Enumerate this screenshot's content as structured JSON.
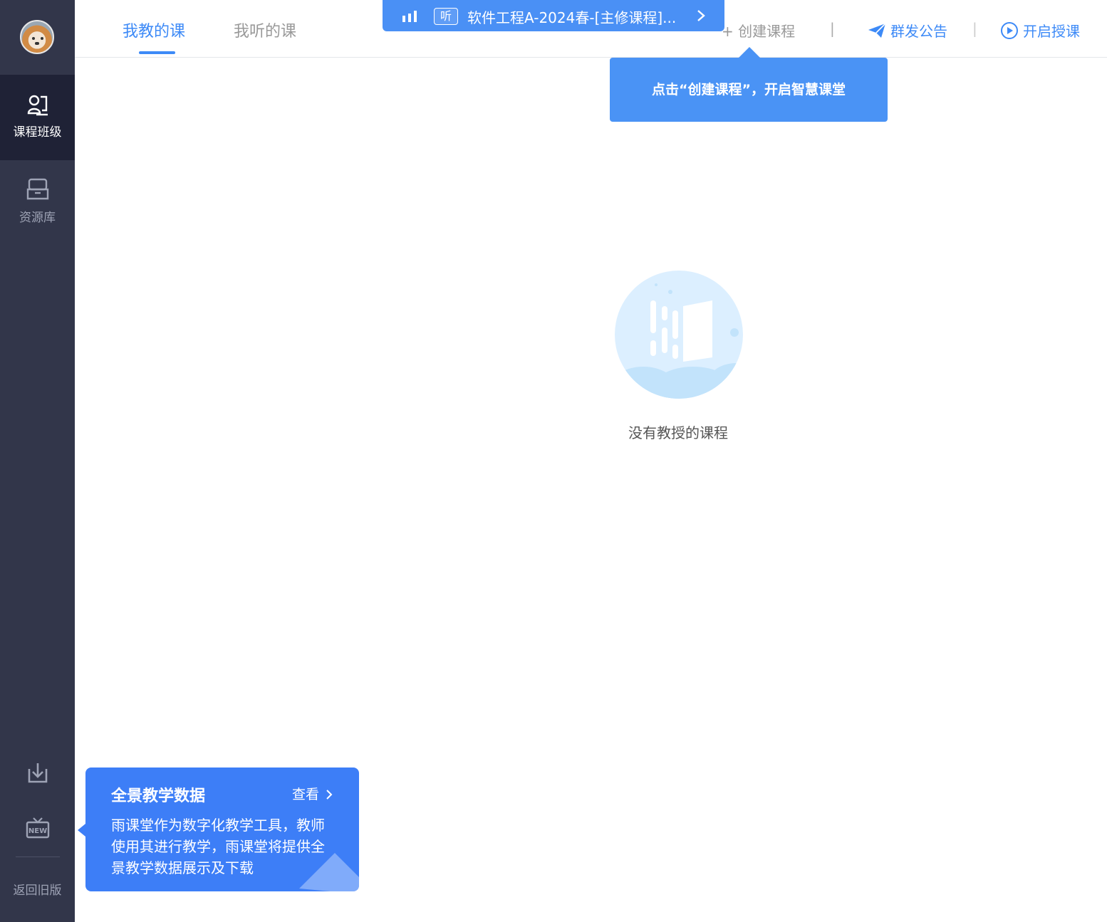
{
  "sidebar": {
    "items": [
      {
        "label": "课程班级",
        "icon": "class-icon",
        "active": true
      },
      {
        "label": "资源库",
        "icon": "resource-icon",
        "active": false
      }
    ],
    "bottom_icons": [
      "download-icon",
      "new-badge-icon"
    ],
    "back_old": "返回旧版"
  },
  "header": {
    "tabs": [
      {
        "label": "我教的课",
        "active": true
      },
      {
        "label": "我听的课",
        "active": false
      }
    ],
    "actions": {
      "create_course": "+ 创建课程",
      "broadcast": "群发公告",
      "start_class": "开启授课",
      "separator": "|"
    }
  },
  "live_banner": {
    "tag": "听",
    "title": "软件工程A-2024春-[主修课程]..."
  },
  "tooltip": {
    "text": "点击“创建课程”，开启智慧课堂"
  },
  "empty_state": {
    "text": "没有教授的课程"
  },
  "promo": {
    "title": "全景教学数据",
    "link": "查看",
    "body": "雨课堂作为数字化教学工具，教师使用其进行教学，雨课堂将提供全景教学数据展示及下载"
  },
  "colors": {
    "sidebar_bg": "#32364a",
    "sidebar_active_bg": "#1f2236",
    "accent": "#3d8af7",
    "promo_bg": "#3d7ef7"
  }
}
